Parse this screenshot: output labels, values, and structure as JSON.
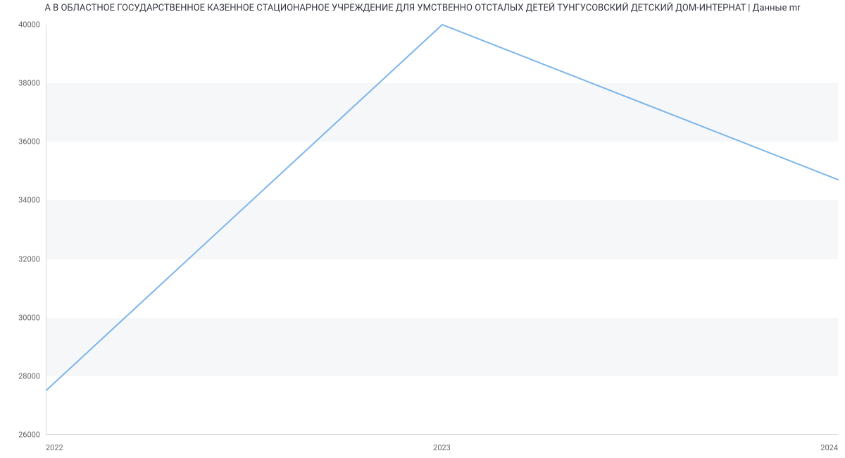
{
  "chart_data": {
    "type": "line",
    "title": "А В ОБЛАСТНОЕ ГОСУДАРСТВЕННОЕ КАЗЕННОЕ СТАЦИОНАРНОЕ УЧРЕЖДЕНИЕ ДЛЯ УМСТВЕННО ОТСТАЛЫХ ДЕТЕЙ ТУНГУСОВСКИЙ ДЕТСКИЙ ДОМ-ИНТЕРНАТ | Данные mr",
    "categories": [
      "2022",
      "2023",
      "2024"
    ],
    "x": [
      2022,
      2023,
      2024
    ],
    "values": [
      27500,
      40000,
      34700
    ],
    "ylim": [
      26000,
      40000
    ],
    "yticks": [
      26000,
      28000,
      30000,
      32000,
      34000,
      36000,
      38000,
      40000
    ],
    "line_color": "#7cb5ec",
    "xlabel": "",
    "ylabel": "",
    "grid_bands": true
  }
}
